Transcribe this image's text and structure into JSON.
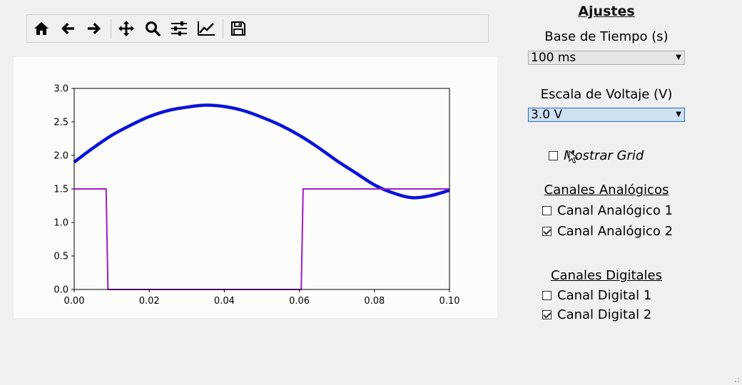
{
  "toolbar": {
    "buttons": [
      {
        "name": "home-icon"
      },
      {
        "name": "back-arrow-icon"
      },
      {
        "name": "forward-arrow-icon"
      },
      {
        "name": "pan-move-icon"
      },
      {
        "name": "zoom-icon"
      },
      {
        "name": "configure-subplots-icon"
      },
      {
        "name": "edit-axis-icon"
      },
      {
        "name": "save-icon"
      }
    ]
  },
  "settings": {
    "title": "Ajustes",
    "timebase_label": "Base de Tiempo (s)",
    "timebase_value": "100 ms",
    "voltage_label": "Escala de Voltaje (V)",
    "voltage_value": "3.0 V",
    "show_grid_label": "Mostrar Grid",
    "show_grid_checked": false,
    "analog_title": "Canales Analógicos",
    "analog_channels": [
      {
        "label": "Canal Analógico 1",
        "checked": false
      },
      {
        "label": "Canal Analógico 2",
        "checked": true
      }
    ],
    "digital_title": "Canales Digitales",
    "digital_channels": [
      {
        "label": "Canal Digital 1",
        "checked": false
      },
      {
        "label": "Canal Digital 2",
        "checked": true
      }
    ]
  },
  "chart_data": {
    "type": "line",
    "xlim": [
      0.0,
      0.1
    ],
    "ylim": [
      0.0,
      3.0
    ],
    "x_ticks": [
      "0.00",
      "0.02",
      "0.04",
      "0.06",
      "0.08",
      "0.10"
    ],
    "y_ticks": [
      "0.0",
      "0.5",
      "1.0",
      "1.5",
      "2.0",
      "2.5",
      "3.0"
    ],
    "grid": false,
    "series": [
      {
        "color": "#0a14d8",
        "x": [
          0.0,
          0.005,
          0.01,
          0.015,
          0.02,
          0.025,
          0.03,
          0.035,
          0.04,
          0.045,
          0.05,
          0.055,
          0.06,
          0.065,
          0.07,
          0.075,
          0.08,
          0.085,
          0.09,
          0.095,
          0.1
        ],
        "y": [
          1.9,
          2.11,
          2.3,
          2.45,
          2.58,
          2.67,
          2.72,
          2.75,
          2.73,
          2.67,
          2.57,
          2.45,
          2.3,
          2.12,
          1.92,
          1.74,
          1.56,
          1.44,
          1.37,
          1.4,
          1.48
        ]
      },
      {
        "color": "#a01cc4",
        "x": [
          0.0,
          0.0085,
          0.009,
          0.0605,
          0.061,
          0.1
        ],
        "y": [
          1.5,
          1.5,
          0.0,
          0.0,
          1.5,
          1.5
        ]
      }
    ]
  }
}
